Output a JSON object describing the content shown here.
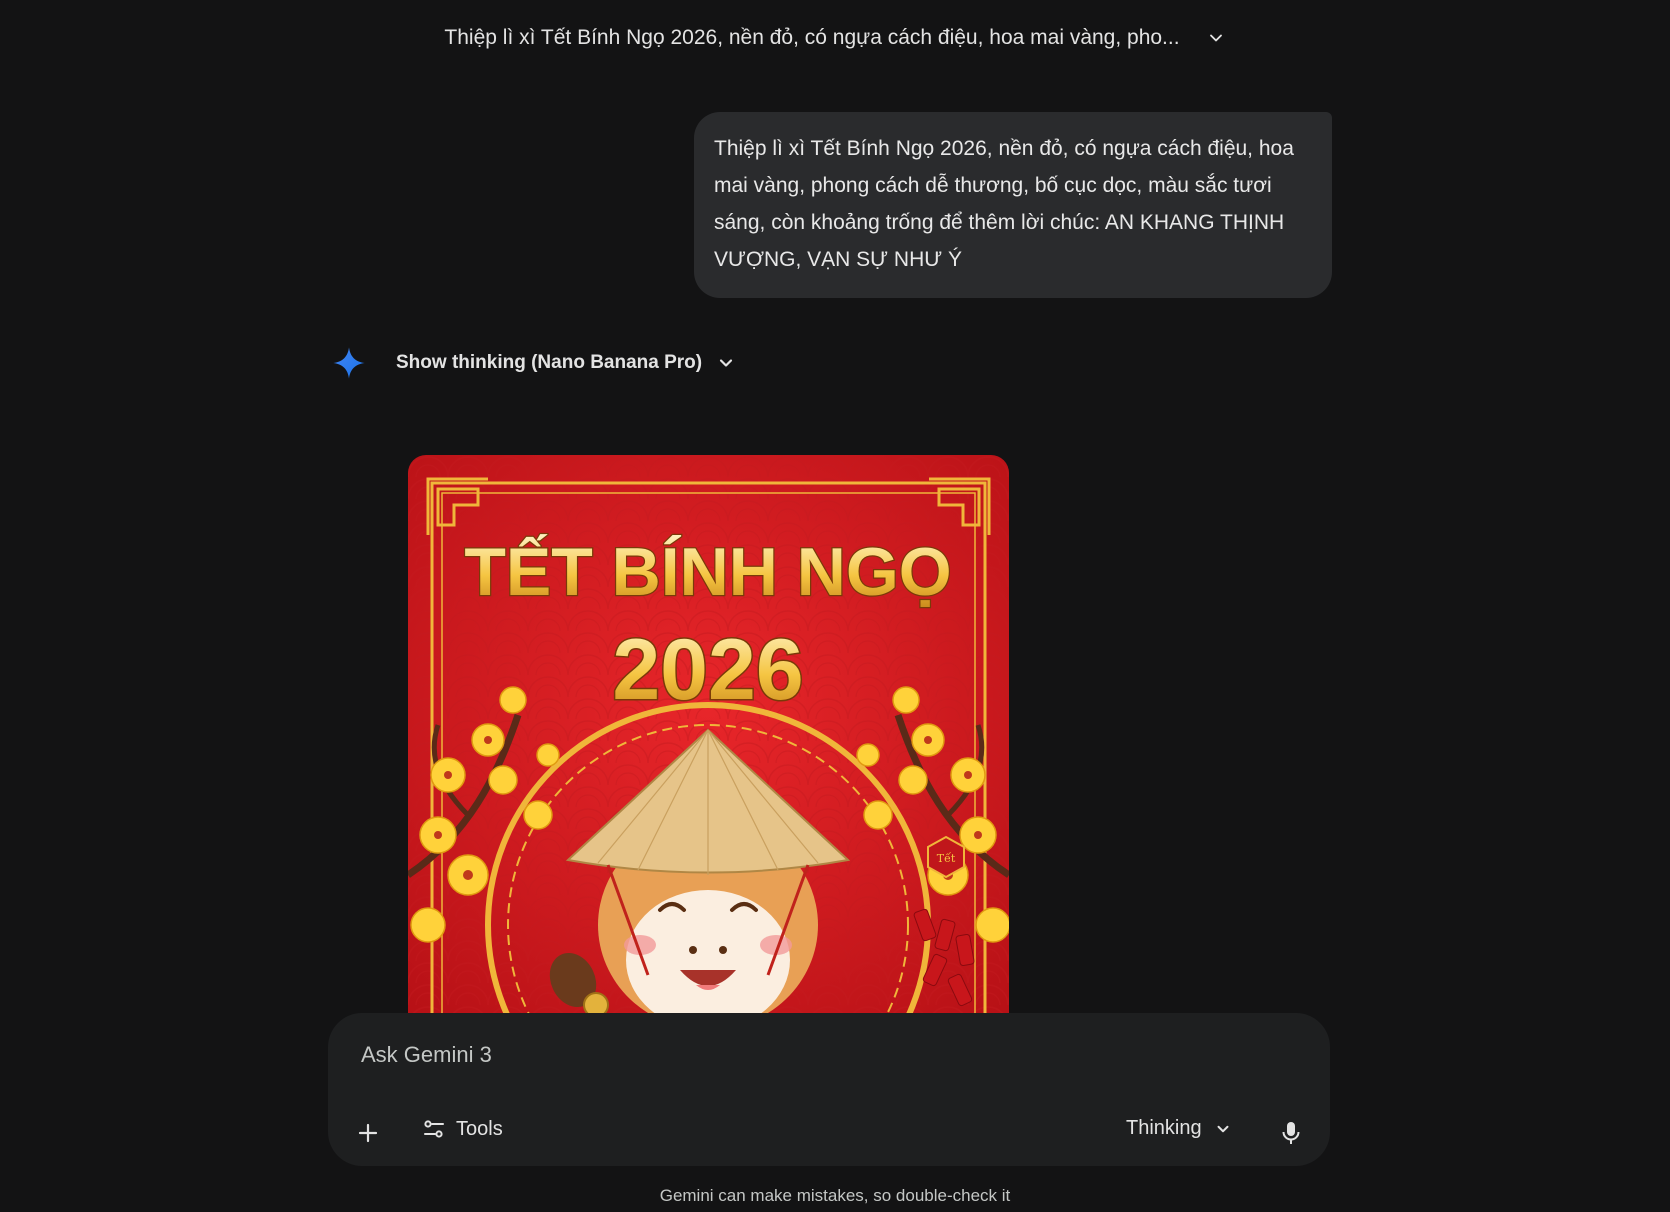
{
  "header": {
    "conversation_title": "Thiệp lì xì Tết Bính Ngọ 2026, nền đỏ, có ngựa cách điệu, hoa mai vàng, pho...",
    "expand_icon": "chevron-down-icon"
  },
  "user_message": {
    "text": "Thiệp lì xì Tết Bính Ngọ 2026, nền đỏ, có ngựa cách điệu, hoa mai vàng, phong cách dễ thương, bố cục dọc, màu sắc tươi sáng, còn khoảng trống để thêm lời chúc: AN KHANG THỊNH VƯỢNG, VẠN SỰ NHƯ Ý"
  },
  "response": {
    "model_icon": "gemini-sparkle-icon",
    "show_thinking_label": "Show thinking (Nano Banana Pro)",
    "image": {
      "title_line1": "TẾT BÍNH NGỌ",
      "title_line2": "2026",
      "badge": "Tết"
    }
  },
  "composer": {
    "placeholder": "Ask Gemini 3",
    "tools_label": "Tools",
    "mode_label": "Thinking"
  },
  "footer": {
    "disclaimer": "Gemini can make mistakes, so double-check it"
  },
  "colors": {
    "background": "#131314",
    "bubble": "#2a2b2d",
    "composer": "#1e1f20",
    "card_red": "#d71920",
    "gold": "#f5c542",
    "gemini_blue": "#4285f4"
  }
}
